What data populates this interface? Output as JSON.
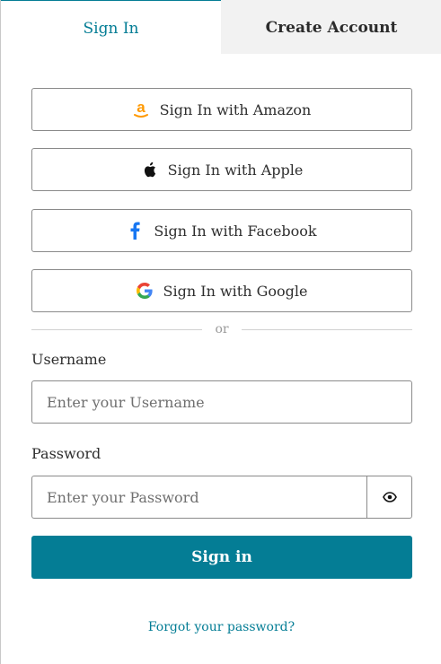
{
  "tabs": {
    "sign_in": "Sign In",
    "create_account": "Create Account"
  },
  "social": {
    "amazon": "Sign In with Amazon",
    "apple": "Sign In with Apple",
    "facebook": "Sign In with Facebook",
    "google": "Sign In with Google"
  },
  "divider": {
    "text": "or"
  },
  "username": {
    "label": "Username",
    "placeholder": "Enter your Username"
  },
  "password": {
    "label": "Password",
    "placeholder": "Enter your Password"
  },
  "submit_label": "Sign in",
  "forgot_link": "Forgot your password?",
  "icons": {
    "amazon": "amazon-logo-icon",
    "apple": "apple-logo-icon",
    "facebook": "facebook-logo-icon",
    "google": "google-logo-icon",
    "password_toggle": "eye-icon"
  },
  "colors": {
    "accent": "#047d95",
    "amazon_orange": "#ff9900",
    "facebook_blue": "#1877f2",
    "inactive_tab_bg": "#f2f2f2"
  }
}
